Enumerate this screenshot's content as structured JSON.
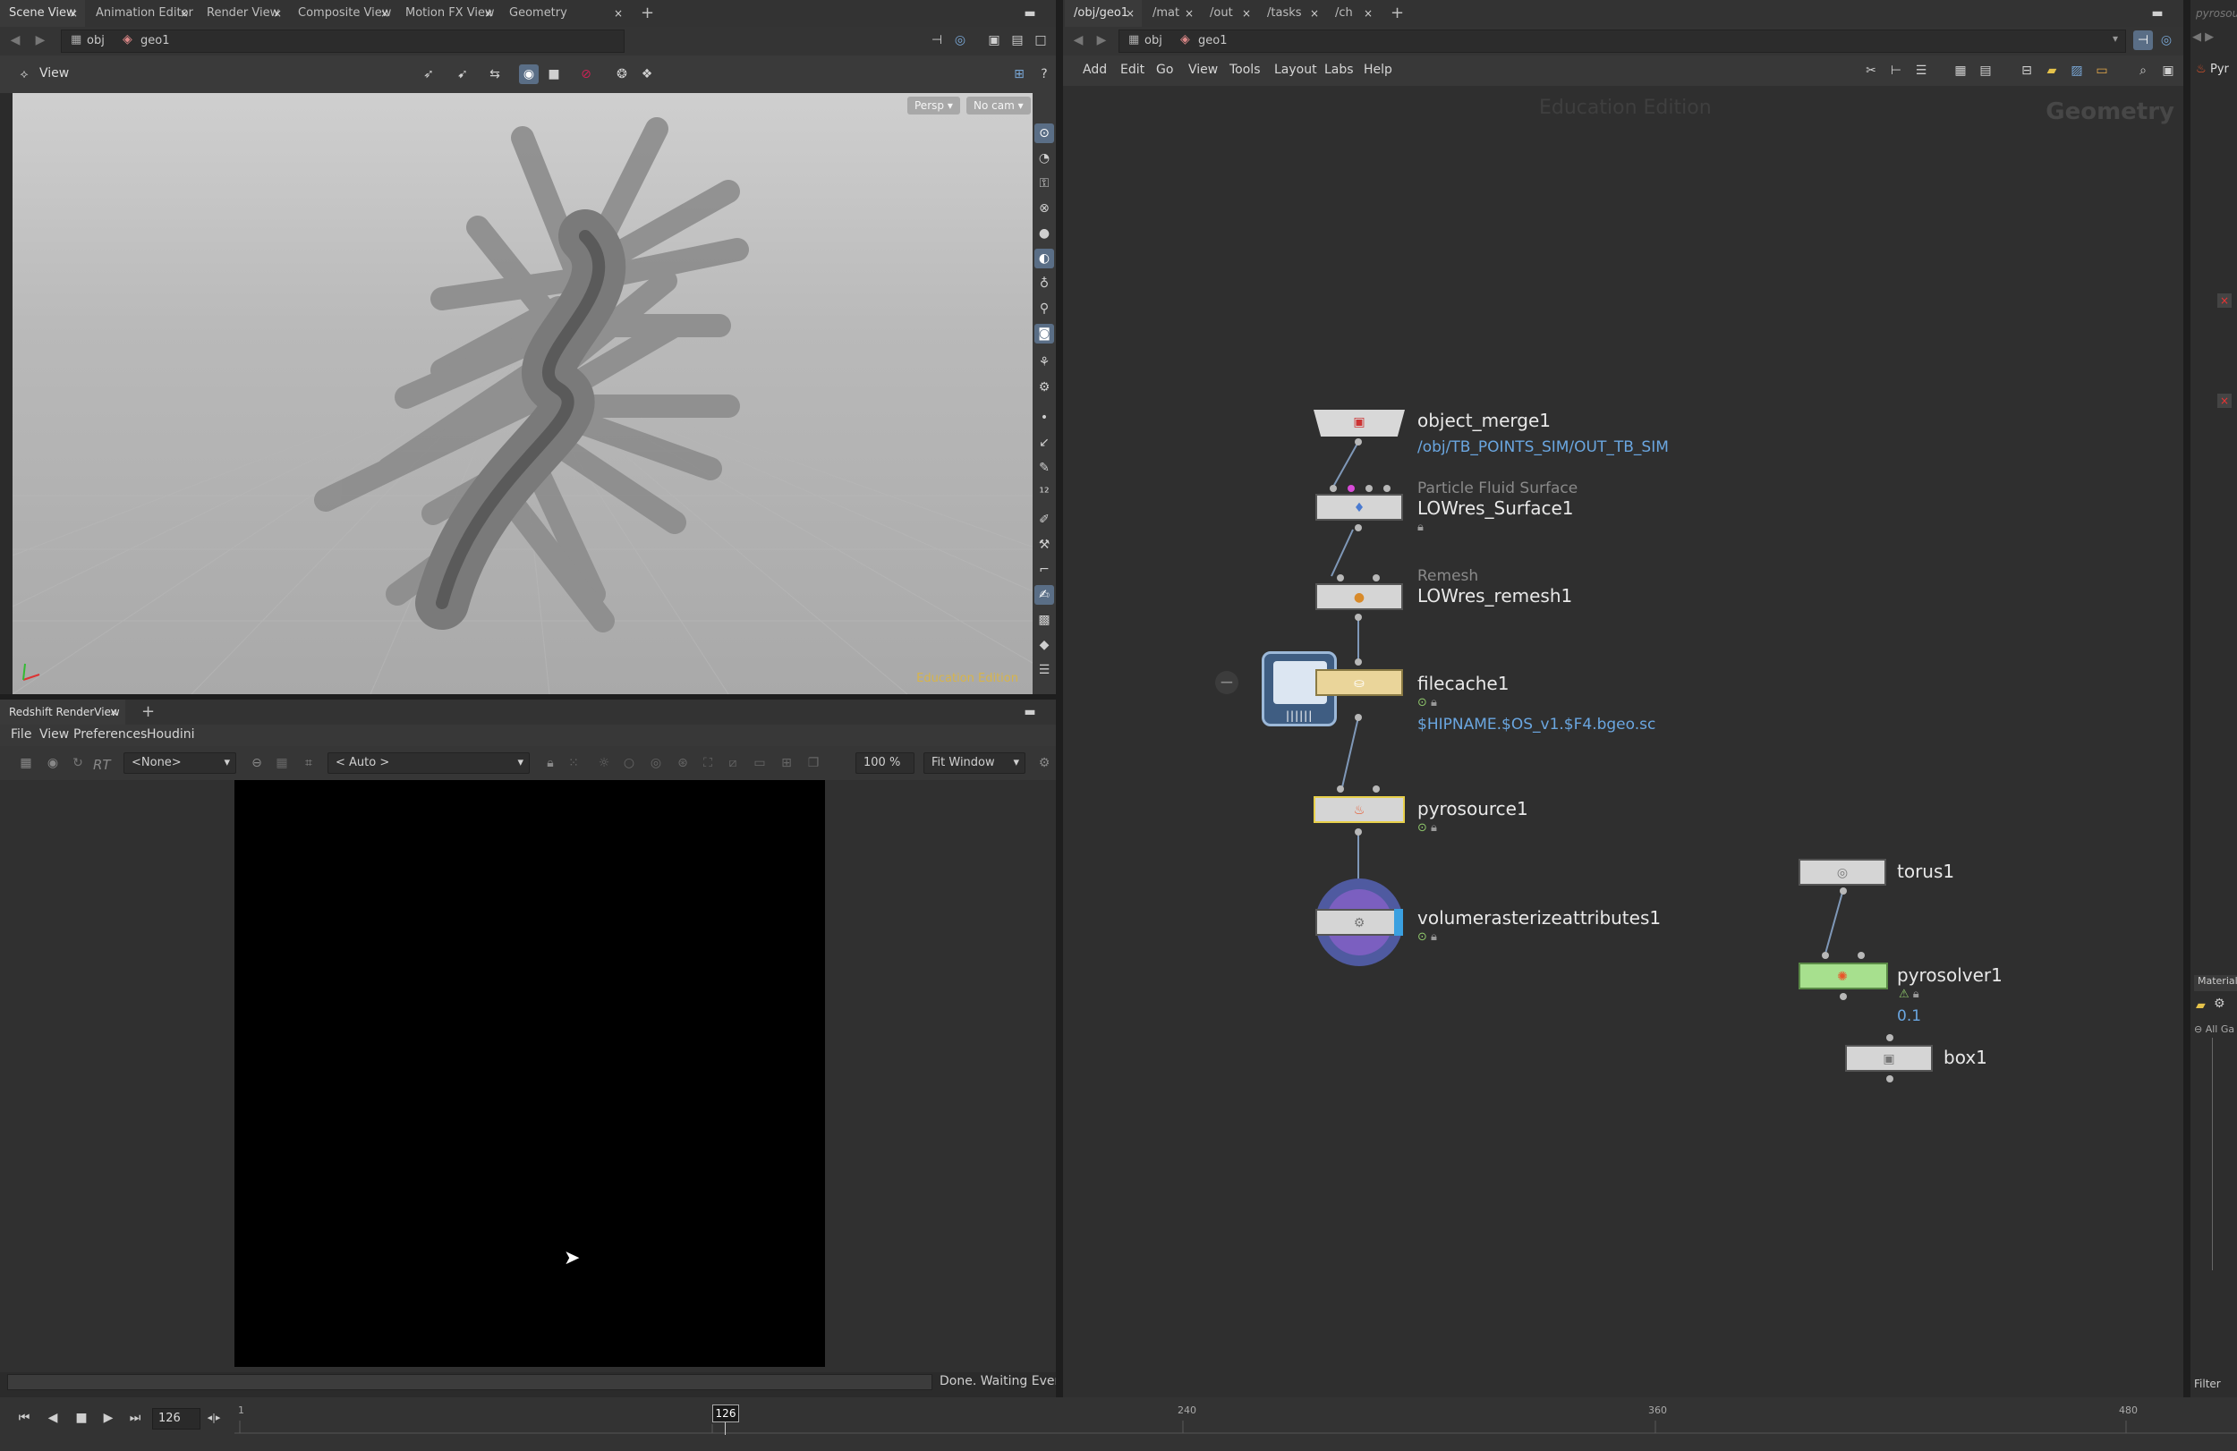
{
  "left_tabs": [
    "Scene View",
    "Animation Editor",
    "Render View",
    "Composite View",
    "Motion FX View",
    "Geometry Spreadsheet"
  ],
  "right_tabs": [
    "/obj/geo1",
    "/mat",
    "/out",
    "/tasks",
    "/ch"
  ],
  "path_left": {
    "context": "obj",
    "node": "geo1"
  },
  "path_right": {
    "context": "obj",
    "node": "geo1"
  },
  "viewport": {
    "label": "View",
    "persp_button": "Persp",
    "cam_button": "No cam",
    "watermark": "Education Edition"
  },
  "render_panel": {
    "tab": "Redshift RenderView",
    "menu": [
      "File",
      "View",
      "Preferences",
      "Houdini"
    ],
    "rt_label": "RT",
    "aov_select": "<None>",
    "mode_select": "< Auto >",
    "zoom": "100 %",
    "fit_select": "Fit Window",
    "status": "Done. Waiting Events"
  },
  "network": {
    "menu": [
      "Add",
      "Edit",
      "Go",
      "View",
      "Tools",
      "Layout",
      "Labs",
      "Help"
    ],
    "edition_watermark": "Education Edition",
    "context_watermark": "Geometry",
    "nodes": {
      "object_merge": {
        "name": "object_merge1",
        "param": "/obj/TB_POINTS_SIM/OUT_TB_SIM"
      },
      "surface": {
        "type": "Particle Fluid Surface",
        "name": "LOWres_Surface1"
      },
      "remesh": {
        "type": "Remesh",
        "name": "LOWres_remesh1"
      },
      "filecache": {
        "name": "filecache1",
        "param": "$HIPNAME.$OS_v1.$F4.bgeo.sc"
      },
      "pyrosource": {
        "name": "pyrosource1"
      },
      "volrast": {
        "name": "volumerasterizeattributes1"
      },
      "torus": {
        "name": "torus1"
      },
      "pyrosolver": {
        "name": "pyrosolver1",
        "param": "0.1"
      },
      "box": {
        "name": "box1"
      }
    }
  },
  "right_edge": {
    "label_top": "pyrosour",
    "label_pyr": "Pyr",
    "material_label": "Material",
    "filter_label": "Filter",
    "tree_label": "All Ga"
  },
  "timeline": {
    "current_frame": "126",
    "marker": "126",
    "ticks": [
      "1",
      "240",
      "360",
      "480"
    ]
  },
  "colors": {
    "accent_blue": "#6aa6e0",
    "edition_yellow": "#d8b54a",
    "node_selected": "#e8d04a",
    "solver_green": "#7fd36e"
  }
}
